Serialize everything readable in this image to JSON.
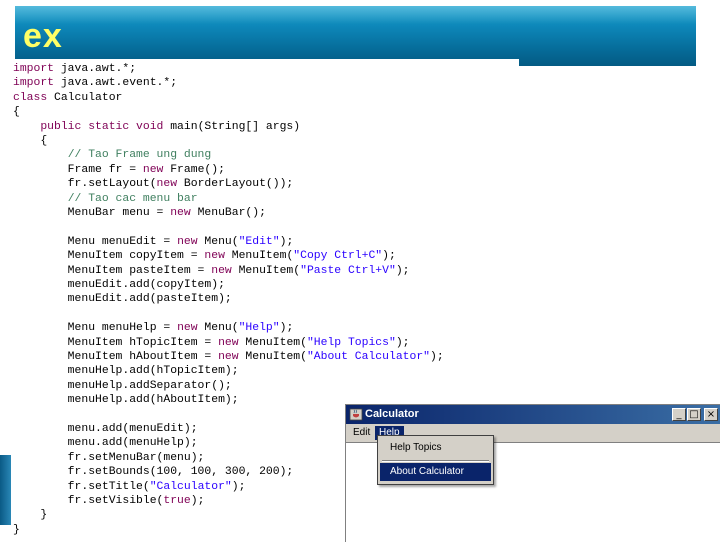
{
  "slide": {
    "title": "ex"
  },
  "code": {
    "lines": [
      {
        "segments": [
          {
            "t": "import",
            "c": "kw"
          },
          {
            "t": " java.awt.*;",
            "c": ""
          }
        ]
      },
      {
        "segments": [
          {
            "t": "import",
            "c": "kw"
          },
          {
            "t": " java.awt.event.*;",
            "c": ""
          }
        ]
      },
      {
        "segments": [
          {
            "t": "class",
            "c": "kw"
          },
          {
            "t": " Calculator",
            "c": ""
          }
        ]
      },
      {
        "segments": [
          {
            "t": "{",
            "c": ""
          }
        ]
      },
      {
        "segments": [
          {
            "t": "    ",
            "c": ""
          },
          {
            "t": "public static void",
            "c": "kw"
          },
          {
            "t": " main(String[] args)",
            "c": ""
          }
        ]
      },
      {
        "segments": [
          {
            "t": "    {",
            "c": ""
          }
        ]
      },
      {
        "segments": [
          {
            "t": "        ",
            "c": ""
          },
          {
            "t": "// Tao Frame ung dung",
            "c": "cm"
          }
        ]
      },
      {
        "segments": [
          {
            "t": "        Frame fr = ",
            "c": ""
          },
          {
            "t": "new",
            "c": "kw"
          },
          {
            "t": " Frame();",
            "c": ""
          }
        ]
      },
      {
        "segments": [
          {
            "t": "        fr.setLayout(",
            "c": ""
          },
          {
            "t": "new",
            "c": "kw"
          },
          {
            "t": " BorderLayout());",
            "c": ""
          }
        ]
      },
      {
        "segments": [
          {
            "t": "        ",
            "c": ""
          },
          {
            "t": "// Tao cac menu bar",
            "c": "cm"
          }
        ]
      },
      {
        "segments": [
          {
            "t": "        MenuBar menu = ",
            "c": ""
          },
          {
            "t": "new",
            "c": "kw"
          },
          {
            "t": " MenuBar();",
            "c": ""
          }
        ]
      },
      {
        "segments": [
          {
            "t": "",
            "c": ""
          }
        ]
      },
      {
        "segments": [
          {
            "t": "        Menu menuEdit = ",
            "c": ""
          },
          {
            "t": "new",
            "c": "kw"
          },
          {
            "t": " Menu(",
            "c": ""
          },
          {
            "t": "\"Edit\"",
            "c": "st"
          },
          {
            "t": ");",
            "c": ""
          }
        ]
      },
      {
        "segments": [
          {
            "t": "        MenuItem copyItem = ",
            "c": ""
          },
          {
            "t": "new",
            "c": "kw"
          },
          {
            "t": " MenuItem(",
            "c": ""
          },
          {
            "t": "\"Copy Ctrl+C\"",
            "c": "st"
          },
          {
            "t": ");",
            "c": ""
          }
        ]
      },
      {
        "segments": [
          {
            "t": "        MenuItem pasteItem = ",
            "c": ""
          },
          {
            "t": "new",
            "c": "kw"
          },
          {
            "t": " MenuItem(",
            "c": ""
          },
          {
            "t": "\"Paste Ctrl+V\"",
            "c": "st"
          },
          {
            "t": ");",
            "c": ""
          }
        ]
      },
      {
        "segments": [
          {
            "t": "        menuEdit.add(copyItem);",
            "c": ""
          }
        ]
      },
      {
        "segments": [
          {
            "t": "        menuEdit.add(pasteItem);",
            "c": ""
          }
        ]
      },
      {
        "segments": [
          {
            "t": "",
            "c": ""
          }
        ]
      },
      {
        "segments": [
          {
            "t": "        Menu menuHelp = ",
            "c": ""
          },
          {
            "t": "new",
            "c": "kw"
          },
          {
            "t": " Menu(",
            "c": ""
          },
          {
            "t": "\"Help\"",
            "c": "st"
          },
          {
            "t": ");",
            "c": ""
          }
        ]
      },
      {
        "segments": [
          {
            "t": "        MenuItem hTopicItem = ",
            "c": ""
          },
          {
            "t": "new",
            "c": "kw"
          },
          {
            "t": " MenuItem(",
            "c": ""
          },
          {
            "t": "\"Help Topics\"",
            "c": "st"
          },
          {
            "t": ");",
            "c": ""
          }
        ]
      },
      {
        "segments": [
          {
            "t": "        MenuItem hAboutItem = ",
            "c": ""
          },
          {
            "t": "new",
            "c": "kw"
          },
          {
            "t": " MenuItem(",
            "c": ""
          },
          {
            "t": "\"About Calculator\"",
            "c": "st"
          },
          {
            "t": ");",
            "c": ""
          }
        ]
      },
      {
        "segments": [
          {
            "t": "        menuHelp.add(hTopicItem);",
            "c": ""
          }
        ]
      },
      {
        "segments": [
          {
            "t": "        menuHelp.addSeparator();",
            "c": ""
          }
        ]
      },
      {
        "segments": [
          {
            "t": "        menuHelp.add(hAboutItem);",
            "c": ""
          }
        ]
      },
      {
        "segments": [
          {
            "t": "",
            "c": ""
          }
        ]
      },
      {
        "segments": [
          {
            "t": "        menu.add(menuEdit);",
            "c": ""
          }
        ]
      },
      {
        "segments": [
          {
            "t": "        menu.add(menuHelp);",
            "c": ""
          }
        ]
      },
      {
        "segments": [
          {
            "t": "        fr.setMenuBar(menu);",
            "c": ""
          }
        ]
      },
      {
        "segments": [
          {
            "t": "        fr.setBounds(100, 100, 300, 200);",
            "c": ""
          }
        ]
      },
      {
        "segments": [
          {
            "t": "        fr.setTitle(",
            "c": ""
          },
          {
            "t": "\"Calculator\"",
            "c": "st"
          },
          {
            "t": ");",
            "c": ""
          }
        ]
      },
      {
        "segments": [
          {
            "t": "        fr.setVisible(",
            "c": ""
          },
          {
            "t": "true",
            "c": "kw"
          },
          {
            "t": ");",
            "c": ""
          }
        ]
      },
      {
        "segments": [
          {
            "t": "    }",
            "c": ""
          }
        ]
      },
      {
        "segments": [
          {
            "t": "}",
            "c": ""
          }
        ]
      }
    ]
  },
  "calculator": {
    "title": "Calculator",
    "menus": [
      "Edit",
      "Help"
    ],
    "help_menu_items": [
      "Help Topics",
      "About Calculator"
    ],
    "window_buttons": {
      "minimize": "_",
      "maximize": "□",
      "close": "×"
    }
  },
  "colors": {
    "header_blue": "#0d86b8",
    "title_yellow": "#ffff66",
    "keyword": "#7f0055",
    "comment": "#3f7f5f",
    "string": "#2a00ff",
    "selection": "#0a246a"
  }
}
